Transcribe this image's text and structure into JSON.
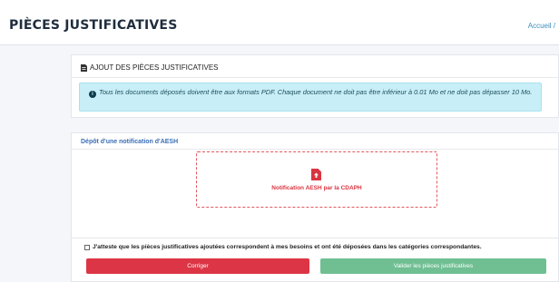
{
  "header": {
    "title": "PIÈCES JUSTIFICATIVES",
    "breadcrumb": "Accueil /"
  },
  "upload_card": {
    "title": "AJOUT DES PIÈCES JUSTIFICATIVES",
    "title_icon": "file-icon",
    "alert_icon": "info-circle-icon",
    "alert_text": "Tous les documents déposés doivent être aux formats PDF. Chaque document ne doit pas être inférieur à 0.01 Mo et ne doit pas dépasser 10 Mo."
  },
  "deposit_card": {
    "title": "Dépôt d'une notification d'AESH",
    "dropzone_icon": "file-upload-icon",
    "dropzone_label": "Notification AESH par la CDAPH"
  },
  "footer": {
    "attest_text": "J'atteste que les pièces justificatives ajoutées correspondent à mes besoins et ont été déposées dans les catégories correspondantes.",
    "attest_checked": false,
    "corriger_label": "Corriger",
    "valider_label": "Valider les pièces justificatives"
  },
  "colors": {
    "danger": "#dc3545",
    "success_disabled": "#6fbf93",
    "info_bg": "#c8eef8",
    "link": "#3c8dbc"
  }
}
